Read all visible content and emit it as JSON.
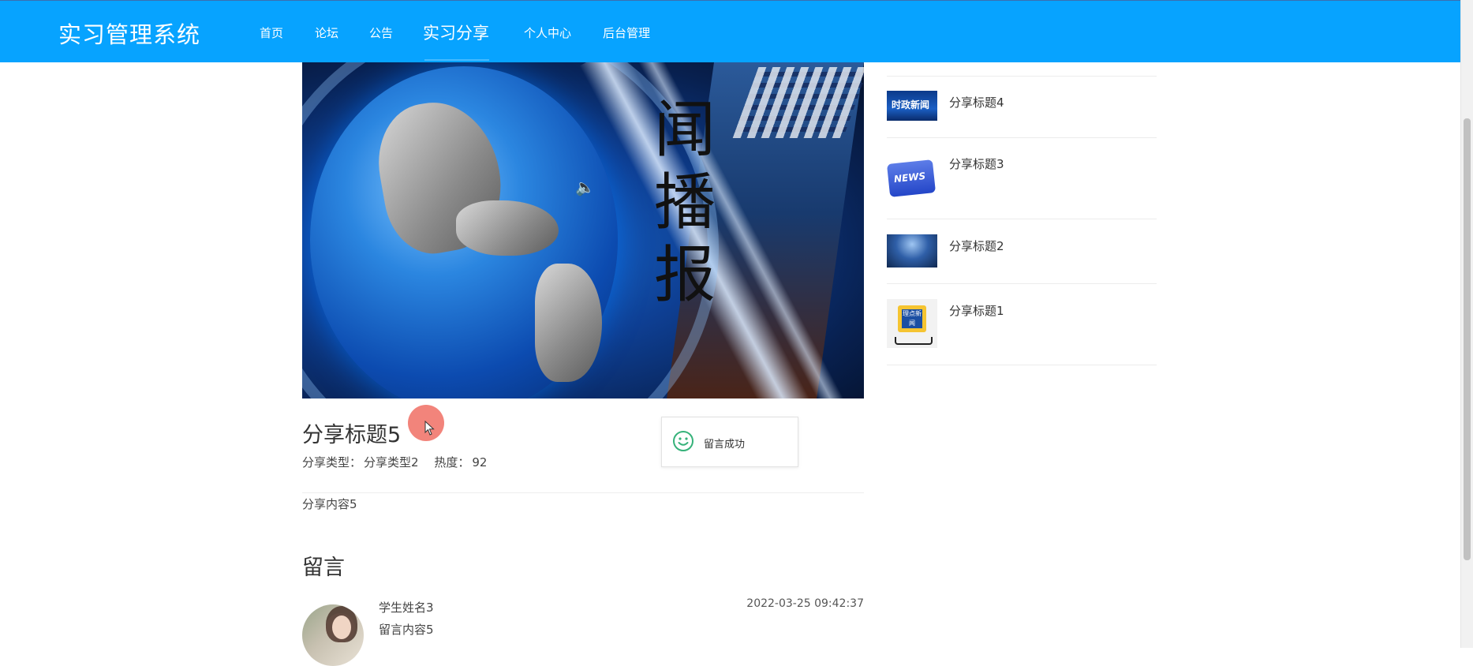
{
  "header": {
    "brand": "实习管理系统",
    "nav": [
      {
        "label": "首页"
      },
      {
        "label": "论坛"
      },
      {
        "label": "公告"
      },
      {
        "label": "实习分享",
        "active": true
      },
      {
        "label": "个人中心"
      },
      {
        "label": "后台管理"
      }
    ],
    "background_color": "#07a3ff"
  },
  "hero": {
    "vertical_text": "闻播报",
    "icon": "speaker-icon"
  },
  "article": {
    "title": "分享标题5",
    "type_label": "分享类型：",
    "type_value": "分享类型2",
    "heat_label": "热度：",
    "heat_value": "92",
    "content": "分享内容5"
  },
  "toast": {
    "message": "留言成功",
    "icon": "smile-icon",
    "icon_color": "#36b27a"
  },
  "comments": {
    "section_title": "留言",
    "items": [
      {
        "name": "学生姓名3",
        "content": "留言内容5",
        "time": "2022-03-25 09:42:37"
      }
    ]
  },
  "sidebar": {
    "items": [
      {
        "title": "分享标题4",
        "thumb_text": "时政新闻"
      },
      {
        "title": "分享标题3",
        "thumb_text": "NEWS"
      },
      {
        "title": "分享标题2"
      },
      {
        "title": "分享标题1",
        "thumb_text": "理点新闻"
      }
    ]
  }
}
